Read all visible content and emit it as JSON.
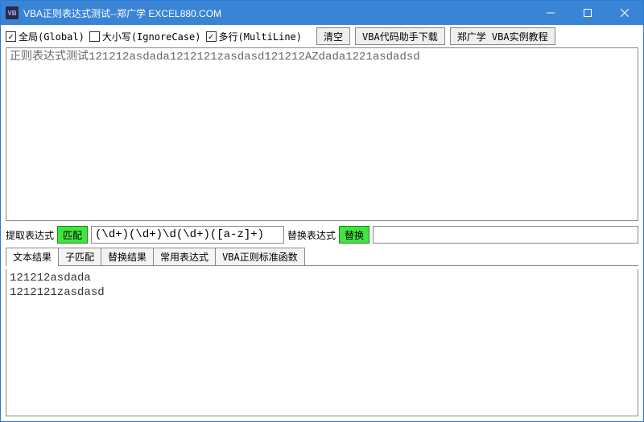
{
  "window": {
    "title": "VBA正则表达式测试--郑广学  EXCEL880.COM"
  },
  "toolbar": {
    "global_label": "全局(Global)",
    "global_checked": true,
    "ignorecase_label": "大小写(IgnoreCase)",
    "ignorecase_checked": false,
    "multiline_label": "多行(MultiLine)",
    "multiline_checked": true,
    "clear_label": "清空",
    "helper_label": "VBA代码助手下载",
    "tutorial_label": "郑广学 VBA实例教程"
  },
  "input_text": "正则表达式测试121212asdada1212121zasdasd121212AZdada1221asdadsd",
  "pattern_row": {
    "extract_label": "提取表达式",
    "match_btn": "匹配",
    "pattern_value": "(\\d+)(\\d+)\\d(\\d+)([a-z]+)",
    "replace_label": "替换表达式",
    "replace_btn": "替换",
    "replace_value": ""
  },
  "tabs": {
    "items": [
      "文本结果",
      "子匹配",
      "替换结果",
      "常用表达式",
      "VBA正则标准函数"
    ],
    "active_index": 0
  },
  "result_text": "121212asdada\n1212121zasdasd"
}
